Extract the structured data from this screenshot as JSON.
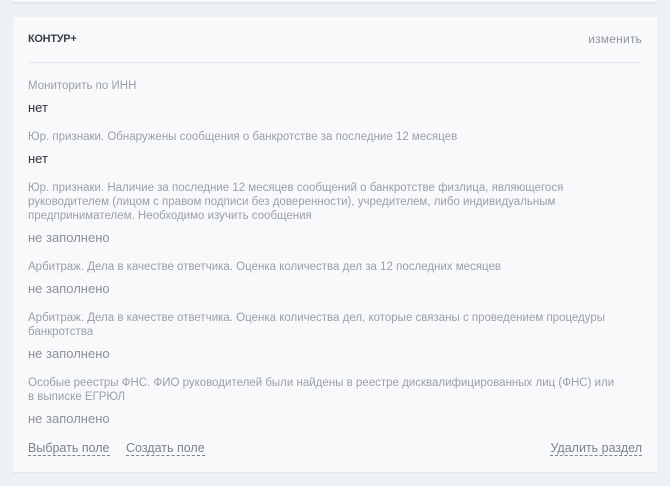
{
  "section": {
    "title": "КОНТУР+",
    "edit_label": "изменить",
    "fields": [
      {
        "label": "Мониторить по ИНН",
        "value": "нет",
        "empty": false
      },
      {
        "label": "Юр. признаки. Обнаружены сообщения о банкротстве за последние 12 месяцев",
        "value": "нет",
        "empty": false
      },
      {
        "label": "Юр. признаки. Наличие за последние 12 месяцев сообщений о банкротстве физлица, являющегося руководителем (лицом с правом подписи без доверенности), учредителем, либо индивидуальным предпринимателем. Необходимо изучить сообщения",
        "value": "не заполнено",
        "empty": true
      },
      {
        "label": "Арбитраж. Дела в качестве ответчика. Оценка количества дел за 12 последних месяцев",
        "value": "не заполнено",
        "empty": true
      },
      {
        "label": "Арбитраж. Дела в качестве ответчика. Оценка количества дел, которые связаны с проведением процедуры банкротства",
        "value": "не заполнено",
        "empty": true
      },
      {
        "label": "Особые реестры ФНС. ФИО руководителей были найдены в реестре дисквалифицированных лиц (ФНС) или в выписке ЕГРЮЛ",
        "value": "не заполнено",
        "empty": true
      }
    ],
    "footer": {
      "select_field": "Выбрать поле",
      "create_field": "Создать поле",
      "delete_section": "Удалить раздел"
    }
  }
}
